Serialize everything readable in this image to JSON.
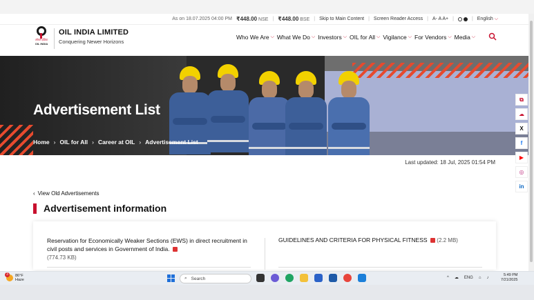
{
  "util": {
    "as_on": "As on 18.07.2025 04:00 PM",
    "nse_price": "₹448.00",
    "nse_label": "NSE",
    "bse_price": "₹448.00",
    "bse_label": "BSE",
    "skip": "Skip to Main Content",
    "screen_reader": "Screen Reader Access",
    "font_sizes": "A-  A  A+",
    "language": "English"
  },
  "brand": {
    "name": "OIL INDIA LIMITED",
    "tagline": "Conquering Newer Horizons",
    "logo_hindi": "ऑयल इंडिया",
    "logo_text": "OIL INDIA"
  },
  "nav": {
    "items": [
      {
        "label": "Who We Are"
      },
      {
        "label": "What We Do"
      },
      {
        "label": "Investors"
      },
      {
        "label": "OIL for All"
      },
      {
        "label": "Vigilance"
      },
      {
        "label": "For Vendors"
      },
      {
        "label": "Media"
      }
    ]
  },
  "hero": {
    "title": "Advertisement List",
    "breadcrumb": [
      "Home",
      "OIL for All",
      "Career at OIL",
      "Advertisement List"
    ]
  },
  "page": {
    "last_updated": "Last updated: 18 Jul, 2025 01:54 PM",
    "view_old": "View Old Advertisements",
    "section_title": "Advertisement information"
  },
  "cards": {
    "left_text": "Reservation for Economically Weaker Sections (EWS) in direct recruitment in civil posts and services in Government of India.",
    "left_size": "(774.73 KB)",
    "right_text": "GUIDELINES AND CRITERIA FOR PHYSICAL FITNESS",
    "right_size": "(2.2 MB)"
  },
  "social": [
    "pdf",
    "cloud",
    "X",
    "f",
    "▶",
    "ig",
    "in"
  ],
  "taskbar": {
    "weather_temp": "86°F",
    "weather_desc": "Haze",
    "weather_badge": "3",
    "search_placeholder": "Search",
    "lang": "ENG",
    "time": "5:49 PM",
    "date": "7/21/2025"
  },
  "colors": {
    "brand_red": "#c8102e",
    "hat_yellow": "#f2d100",
    "uniform_blue": "#3d5f99"
  }
}
